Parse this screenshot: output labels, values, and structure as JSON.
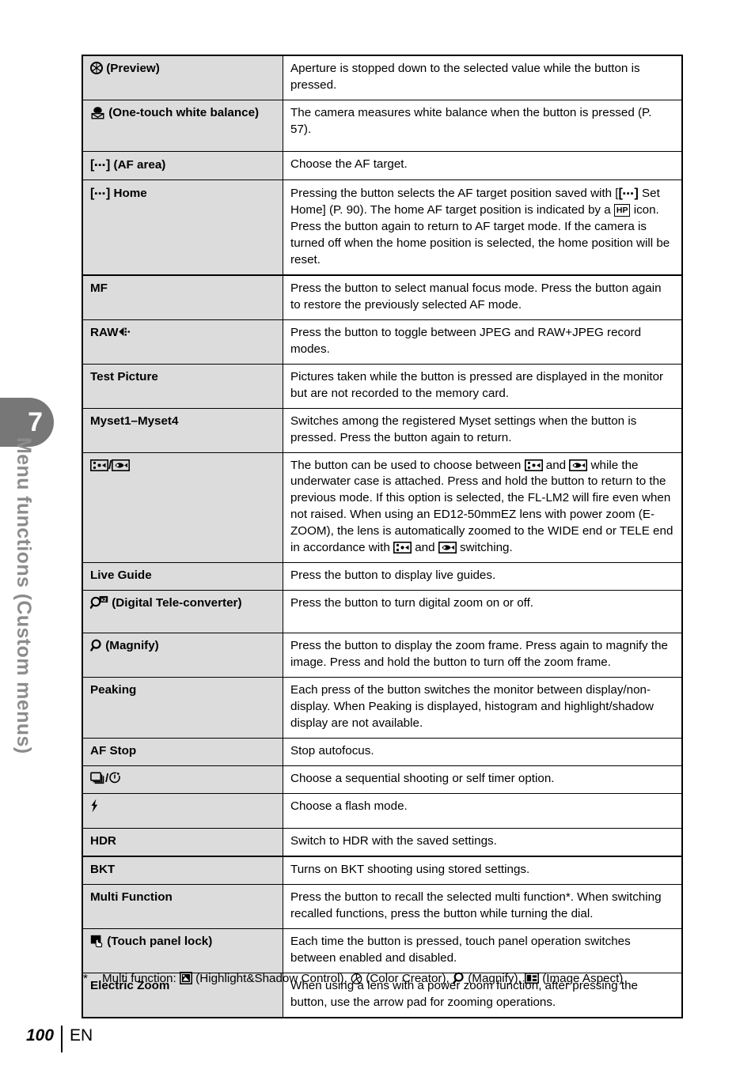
{
  "sidebar": {
    "chapter_number": "7",
    "chapter_title": "Menu functions (Custom menus)"
  },
  "footer": {
    "page_number": "100",
    "language": "EN"
  },
  "footnote": {
    "marker": "*",
    "lead": "Multi function:",
    "items": [
      {
        "icon": "highlight-shadow-control-icon",
        "label": "(Highlight&Shadow Control),"
      },
      {
        "icon": "color-creator-icon",
        "label": "(Color Creator),"
      },
      {
        "icon": "magnify-icon",
        "label": "(Magnify),"
      },
      {
        "icon": "image-aspect-icon",
        "label": "(Image Aspect)"
      }
    ]
  },
  "table": {
    "rows": [
      {
        "id": "preview",
        "icon": "aperture-preview-icon",
        "label": "(Preview)",
        "description": "Aperture is stopped down to the selected value while the button is pressed."
      },
      {
        "id": "one-touch-white-balance",
        "icon": "one-touch-white-balance-icon",
        "label": "(One-touch white balance)",
        "description": "The camera measures white balance when the button is pressed (P. 57)."
      },
      {
        "id": "af-area",
        "icon": "af-target-bracket-icon",
        "label": "(AF area)",
        "description": "Choose the AF target."
      },
      {
        "id": "home",
        "icon": "af-target-bracket-icon",
        "label": "Home",
        "description_part1": "Pressing the button selects the AF target position saved with [",
        "description_part2": " Set Home] (P. 90). The home AF target position is indicated by a ",
        "hp_icon_text": "HP",
        "description_part3": " icon. Press the button again to return to AF target mode. If the camera is turned off when the home position is selected, the home position will be reset."
      },
      {
        "id": "mf",
        "label": "MF",
        "description": "Press the button to select manual focus mode. Press the button again to restore the previously selected AF mode."
      },
      {
        "id": "raw",
        "label": "RAW",
        "icon": "raw-quality-icon",
        "description": "Press the button to toggle between JPEG and RAW+JPEG record modes."
      },
      {
        "id": "test-picture",
        "label": "Test Picture",
        "description": "Pictures taken while the button is pressed are displayed in the monitor but are not recorded to the memory card."
      },
      {
        "id": "myset",
        "label": "Myset1–Myset4",
        "description": "Switches among the registered Myset settings when the button is pressed. Press the button again to return."
      },
      {
        "id": "underwater",
        "icon_wide": "underwater-wide-icon",
        "icon_macro": "underwater-macro-icon",
        "separator": "/",
        "desc_a": "The button can be used to choose between ",
        "desc_b": " and ",
        "desc_c": " while the underwater case is attached. Press and hold the button to return to the previous mode. If this option is selected, the FL-LM2 will fire even when not raised. When using an ED12-50mmEZ lens with power zoom (E-ZOOM), the lens is automatically zoomed to the WIDE end or TELE end in accordance with ",
        "desc_d": " and ",
        "desc_e": " switching."
      },
      {
        "id": "live-guide",
        "label": "Live Guide",
        "description": "Press the button to display live guides."
      },
      {
        "id": "digital-tele-converter",
        "icon": "digital-teleconverter-icon",
        "label": "(Digital Tele-converter)",
        "description": "Press the button to turn digital zoom on or off."
      },
      {
        "id": "magnify",
        "icon": "magnify-icon",
        "label": "(Magnify)",
        "description": "Press the button to display the zoom frame. Press again to magnify the image. Press and hold the button to turn off the zoom frame."
      },
      {
        "id": "peaking",
        "label": "Peaking",
        "description": "Each press of the button switches the monitor between display/non-display. When Peaking is displayed, histogram and highlight/shadow display are not available."
      },
      {
        "id": "af-stop",
        "label": "AF Stop",
        "description": "Stop autofocus."
      },
      {
        "id": "drive-selftimer",
        "icon_drive": "sequential-shooting-icon",
        "icon_timer": "self-timer-icon",
        "separator": "/",
        "description": "Choose a sequential shooting or self timer option."
      },
      {
        "id": "flash",
        "icon": "flash-icon",
        "description": "Choose a flash mode."
      },
      {
        "id": "hdr",
        "label": "HDR",
        "description": "Switch to HDR with the saved settings."
      },
      {
        "id": "bkt",
        "label": "BKT",
        "description": "Turns on BKT shooting using stored settings."
      },
      {
        "id": "multi-function",
        "label": "Multi Function",
        "description": "Press the button to recall the selected multi function*. When switching recalled functions, press the button while turning the dial."
      },
      {
        "id": "touch-panel-lock",
        "icon": "touch-panel-lock-icon",
        "label": "(Touch panel lock)",
        "description": "Each time the button is pressed, touch panel operation switches between enabled and disabled."
      },
      {
        "id": "electric-zoom",
        "label": "Electric Zoom",
        "description": "When using a lens with a power zoom function, after pressing the button, use the arrow pad for zooming operations."
      }
    ]
  },
  "colors": {
    "left_column_background": "#dcdcdc",
    "sidebar_tab": "#777777",
    "sidebar_text": "#8c8c8c",
    "text": "#000000"
  }
}
